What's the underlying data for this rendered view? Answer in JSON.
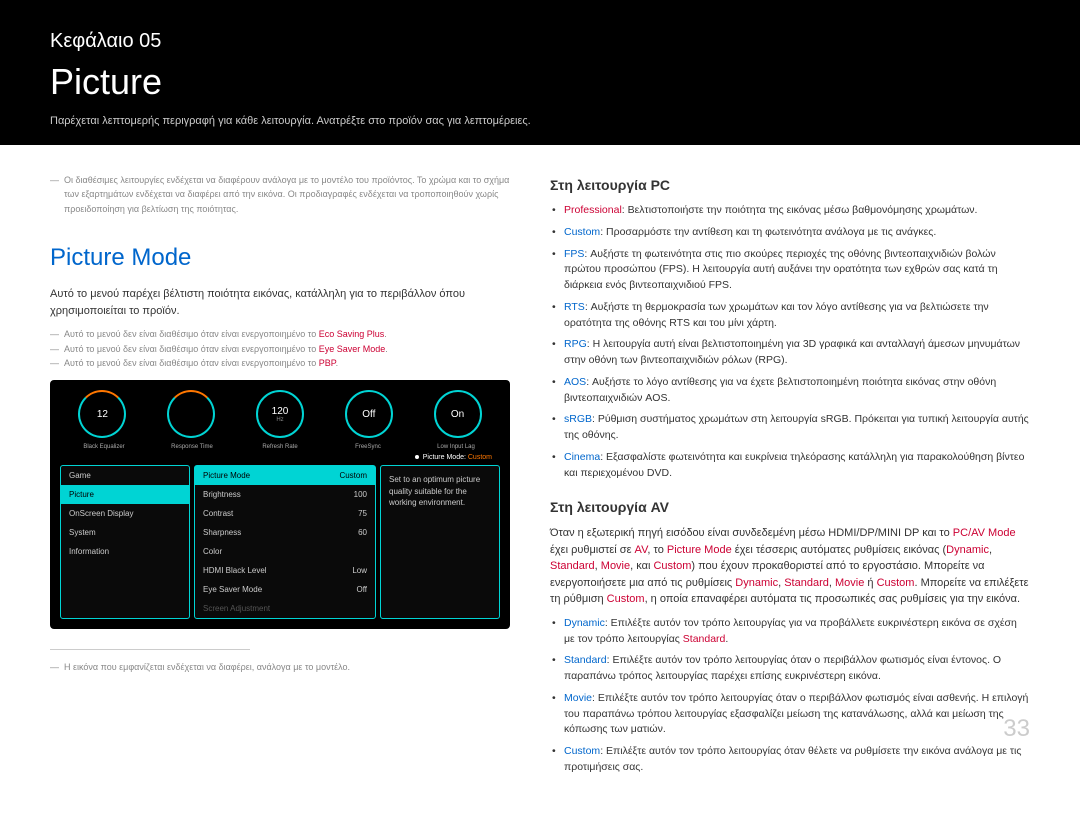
{
  "header": {
    "chapter": "Κεφάλαιο 05",
    "title": "Picture",
    "subtitle": "Παρέχεται λεπτομερής περιγραφή για κάθε λειτουργία. Ανατρέξτε στο προϊόν σας για λεπτομέρειες."
  },
  "left": {
    "note1": "Οι διαθέσιμες λειτουργίες ενδέχεται να διαφέρουν ανάλογα με το μοντέλο του προϊόντος. Το χρώμα και το σχήμα των εξαρτημάτων ενδέχεται να διαφέρει από την εικόνα. Οι προδιαγραφές ενδέχεται να τροποποιηθούν χωρίς προειδοποίηση για βελτίωση της ποιότητας.",
    "section_title": "Picture Mode",
    "intro": "Αυτό το μενού παρέχει βέλτιστη ποιότητα εικόνας, κατάλληλη για το περιβάλλον όπου χρησιμοποιείται το προϊόν.",
    "sub_note_prefix": "Αυτό το μενού δεν είναι διαθέσιμο όταν είναι ενεργοποιημένο το ",
    "sub_note_1_kw": "Eco Saving Plus",
    "sub_note_2_kw": "Eye Saver Mode",
    "sub_note_3_kw": "PBP",
    "footer_note": "Η εικόνα που εμφανίζεται ενδέχεται να διαφέρει, ανάλογα με το μοντέλο."
  },
  "osd": {
    "gauges": [
      "12",
      "",
      "120",
      "Off",
      "On"
    ],
    "gauge3_sub": "Hz",
    "gauge_labels": [
      "Black Equalizer",
      "Response Time",
      "Refresh Rate",
      "FreeSync",
      "Low Input Lag"
    ],
    "pm_label": "Picture Mode:",
    "pm_value": "Custom",
    "left_menu": [
      "Game",
      "Picture",
      "OnScreen Display",
      "System",
      "Information"
    ],
    "left_active": "Picture",
    "mid": [
      {
        "l": "Picture Mode",
        "v": "Custom",
        "hl": true
      },
      {
        "l": "Brightness",
        "v": "100"
      },
      {
        "l": "Contrast",
        "v": "75"
      },
      {
        "l": "Sharpness",
        "v": "60"
      },
      {
        "l": "Color",
        "v": ""
      },
      {
        "l": "HDMI Black Level",
        "v": "Low"
      },
      {
        "l": "Eye Saver Mode",
        "v": "Off"
      },
      {
        "l": "Screen Adjustment",
        "v": "",
        "dim": true
      }
    ],
    "desc": "Set to an optimum picture quality suitable for the working environment."
  },
  "right": {
    "pc_heading": "Στη λειτουργία PC",
    "pc": [
      {
        "kw": "Professional",
        "cls": "kw-red",
        "txt": ": Βελτιστοποιήστε την ποιότητα της εικόνας μέσω βαθμονόμησης χρωμάτων."
      },
      {
        "kw": "Custom",
        "cls": "kw-blue",
        "txt": ": Προσαρμόστε την αντίθεση και τη φωτεινότητα ανάλογα με τις ανάγκες."
      },
      {
        "kw": "FPS",
        "cls": "kw-blue",
        "txt": ": Αυξήστε τη φωτεινότητα στις πιο σκούρες περιοχές της οθόνης βιντεοπαιχνιδιών βολών πρώτου προσώπου (FPS). Η λειτουργία αυτή αυξάνει την ορατότητα των εχθρών σας κατά τη διάρκεια ενός βιντεοπαιχνιδιού FPS."
      },
      {
        "kw": "RTS",
        "cls": "kw-blue",
        "txt": ": Αυξήστε τη θερμοκρασία των χρωμάτων και τον λόγο αντίθεσης για να βελτιώσετε την ορατότητα της οθόνης RTS και του μίνι χάρτη."
      },
      {
        "kw": "RPG",
        "cls": "kw-blue",
        "txt": ": Η λειτουργία αυτή είναι βελτιστοποιημένη για 3D γραφικά και ανταλλαγή άμεσων μηνυμάτων στην οθόνη των βιντεοπαιχνιδιών ρόλων (RPG)."
      },
      {
        "kw": "AOS",
        "cls": "kw-blue",
        "txt": ": Αυξήστε το λόγο αντίθεσης για να έχετε βελτιστοποιημένη ποιότητα εικόνας στην οθόνη βιντεοπαιχνιδιών AOS."
      },
      {
        "kw": "sRGB",
        "cls": "kw-blue",
        "txt": ": Ρύθμιση συστήματος χρωμάτων στη λειτουργία sRGB. Πρόκειται για τυπική λειτουργία αυτής της οθόνης."
      },
      {
        "kw": "Cinema",
        "cls": "kw-blue",
        "txt": ": Εξασφαλίστε φωτεινότητα και ευκρίνεια τηλεόρασης κατάλληλη για παρακολούθηση βίντεο και περιεχομένου DVD."
      }
    ],
    "av_heading": "Στη λειτουργία AV",
    "av_intro_1": "Όταν η εξωτερική πηγή εισόδου είναι συνδεδεμένη μέσω HDMI/DP/MINI DP και το ",
    "av_intro_kw1": "PC/AV Mode",
    "av_intro_2": " έχει ρυθμιστεί σε ",
    "av_intro_kw2": "AV",
    "av_intro_3": ", το ",
    "av_intro_kw3": "Picture Mode",
    "av_intro_4": " έχει τέσσερις αυτόματες ρυθμίσεις εικόνας (",
    "av_list1": [
      "Dynamic",
      "Standard",
      "Movie",
      "Custom"
    ],
    "av_intro_5": ") που έχουν προκαθοριστεί από το εργοστάσιο. Μπορείτε να ενεργοποιήσετε μια από τις ρυθμίσεις ",
    "av_list2": [
      "Dynamic",
      "Standard",
      "Movie",
      "Custom"
    ],
    "av_intro_6": ". Μπορείτε να επιλέξετε τη ρύθμιση ",
    "av_intro_kw4": "Custom",
    "av_intro_7": ", η οποία επαναφέρει αυτόματα τις προσωπικές σας ρυθμίσεις για την εικόνα.",
    "av": [
      {
        "kw": "Dynamic",
        "txt_a": ": Επιλέξτε αυτόν τον τρόπο λειτουργίας για να προβάλλετε ευκρινέστερη εικόνα σε σχέση με τον τρόπο λειτουργίας ",
        "kw2": "Standard",
        "txt_b": "."
      },
      {
        "kw": "Standard",
        "txt_a": ": Επιλέξτε αυτόν τον τρόπο λειτουργίας όταν ο περιβάλλον φωτισμός είναι έντονος. Ο παραπάνω τρόπος λειτουργίας παρέχει επίσης ευκρινέστερη εικόνα."
      },
      {
        "kw": "Movie",
        "txt_a": ": Επιλέξτε αυτόν τον τρόπο λειτουργίας όταν ο περιβάλλον φωτισμός είναι ασθενής. Η επιλογή του παραπάνω τρόπου λειτουργίας εξασφαλίζει μείωση της κατανάλωσης, αλλά και μείωση της κόπωσης των ματιών."
      },
      {
        "kw": "Custom",
        "txt_a": ": Επιλέξτε αυτόν τον τρόπο λειτουργίας όταν θέλετε να ρυθμίσετε την εικόνα ανάλογα με τις προτιμήσεις σας."
      }
    ]
  },
  "page_number": "33"
}
